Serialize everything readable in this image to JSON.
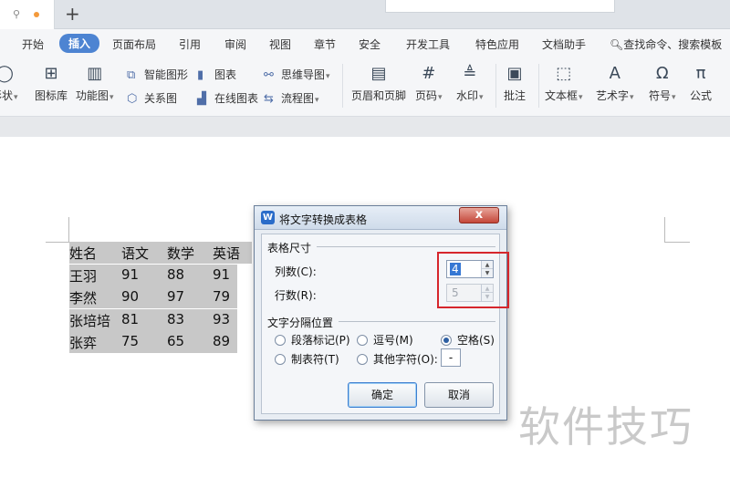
{
  "tabbar": {
    "new_tab": "+"
  },
  "menu": {
    "items": [
      "开始",
      "插入",
      "页面布局",
      "引用",
      "审阅",
      "视图",
      "章节",
      "安全",
      "开发工具",
      "特色应用",
      "文档助手"
    ],
    "active_index": 1,
    "search": "查找命令、搜索模板"
  },
  "ribbon": {
    "shapes": "形状",
    "icon_lib": "图标库",
    "func_chart": "功能图",
    "smart_graphic": "智能图形",
    "chart": "图表",
    "relation": "关系图",
    "online_chart": "在线图表",
    "mindmap": "思维导图",
    "flowchart": "流程图",
    "header_footer": "页眉和页脚",
    "page_num": "页码",
    "watermark": "水印",
    "comment": "批注",
    "textbox": "文本框",
    "art_text": "艺术字",
    "symbol": "符号",
    "formula": "公式"
  },
  "document": {
    "rows": [
      [
        "姓名",
        "语文",
        "数学",
        "英语"
      ],
      [
        "王羽",
        "91",
        "88",
        "91"
      ],
      [
        "李然",
        "90",
        "97",
        "79"
      ],
      [
        "张培培",
        "81",
        "83",
        "93"
      ],
      [
        "张弈",
        "75",
        "65",
        "89"
      ]
    ]
  },
  "watermark_text": "软件技巧",
  "dialog": {
    "logo": "W",
    "title": "将文字转换成表格",
    "close": "x",
    "size_group": "表格尺寸",
    "cols_label": "列数(C):",
    "cols_value": "4",
    "rows_label": "行数(R):",
    "rows_value": "5",
    "separator_group": "文字分隔位置",
    "options": {
      "paragraph": "段落标记(P)",
      "comma": "逗号(M)",
      "space": "空格(S)",
      "tab": "制表符(T)",
      "other": "其他字符(O):"
    },
    "selected_option": "space",
    "other_value": "-",
    "ok": "确定",
    "cancel": "取消"
  },
  "colors": {
    "accent": "#4d84d2",
    "highlight_box": "#d6262c",
    "selection": "#c8c8c8"
  }
}
